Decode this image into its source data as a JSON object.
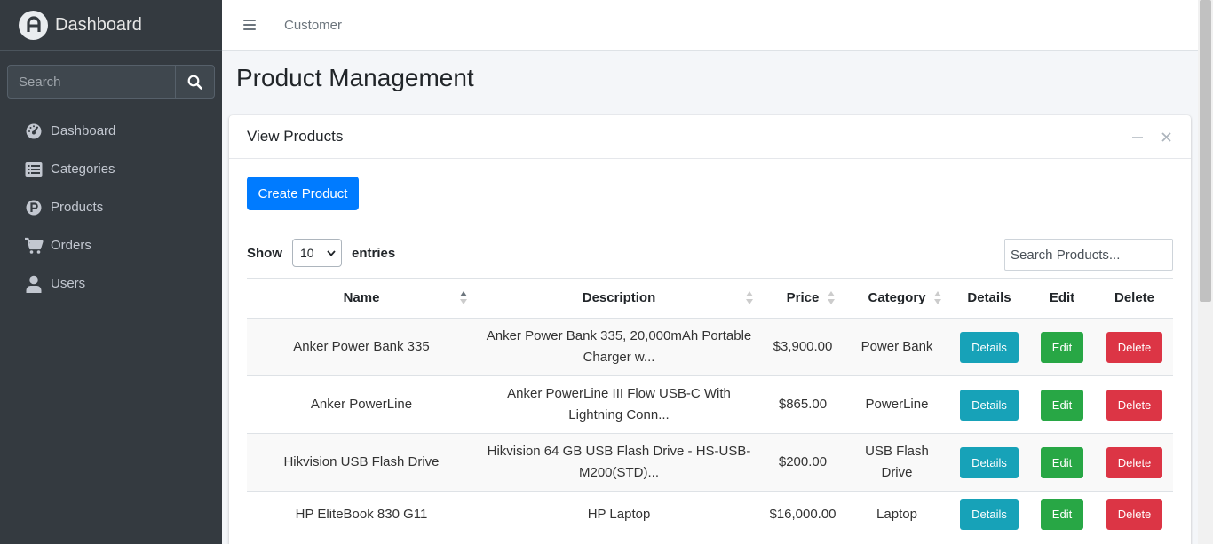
{
  "brand": {
    "title": "Dashboard",
    "logo_icon": "brand-logo-icon"
  },
  "sidebar": {
    "search_placeholder": "Search",
    "items": [
      {
        "label": "Dashboard",
        "icon": "tachometer-icon"
      },
      {
        "label": "Categories",
        "icon": "list-icon"
      },
      {
        "label": "Products",
        "icon": "product-p-icon"
      },
      {
        "label": "Orders",
        "icon": "cart-icon"
      },
      {
        "label": "Users",
        "icon": "user-icon"
      }
    ]
  },
  "topbar": {
    "link": "Customer"
  },
  "page": {
    "title": "Product Management"
  },
  "card": {
    "title": "View Products",
    "create_label": "Create Product",
    "show_label": "Show",
    "entries_label": "entries",
    "page_length": "10",
    "search_placeholder": "Search Products..."
  },
  "table": {
    "headers": [
      "Name",
      "Description",
      "Price",
      "Category",
      "Details",
      "Edit",
      "Delete"
    ],
    "rows": [
      {
        "name": "Anker Power Bank 335",
        "description": "Anker Power Bank 335, 20,000mAh Portable Charger w...",
        "price": "$3,900.00",
        "category": "Power Bank",
        "details": "Details",
        "edit": "Edit",
        "delete": "Delete"
      },
      {
        "name": "Anker PowerLine",
        "description": "Anker PowerLine III Flow USB-C With Lightning Conn...",
        "price": "$865.00",
        "category": "PowerLine",
        "details": "Details",
        "edit": "Edit",
        "delete": "Delete"
      },
      {
        "name": "Hikvision USB Flash Drive",
        "description": "Hikvision 64 GB USB Flash Drive - HS-USB-M200(STD)...",
        "price": "$200.00",
        "category": "USB Flash Drive",
        "details": "Details",
        "edit": "Edit",
        "delete": "Delete"
      },
      {
        "name": "HP EliteBook 830 G11",
        "description": "HP Laptop",
        "price": "$16,000.00",
        "category": "Laptop",
        "details": "Details",
        "edit": "Edit",
        "delete": "Delete"
      }
    ]
  },
  "colors": {
    "sidebar_bg": "#343a40",
    "primary": "#007bff",
    "info": "#17a2b8",
    "success": "#28a745",
    "danger": "#dc3545"
  }
}
